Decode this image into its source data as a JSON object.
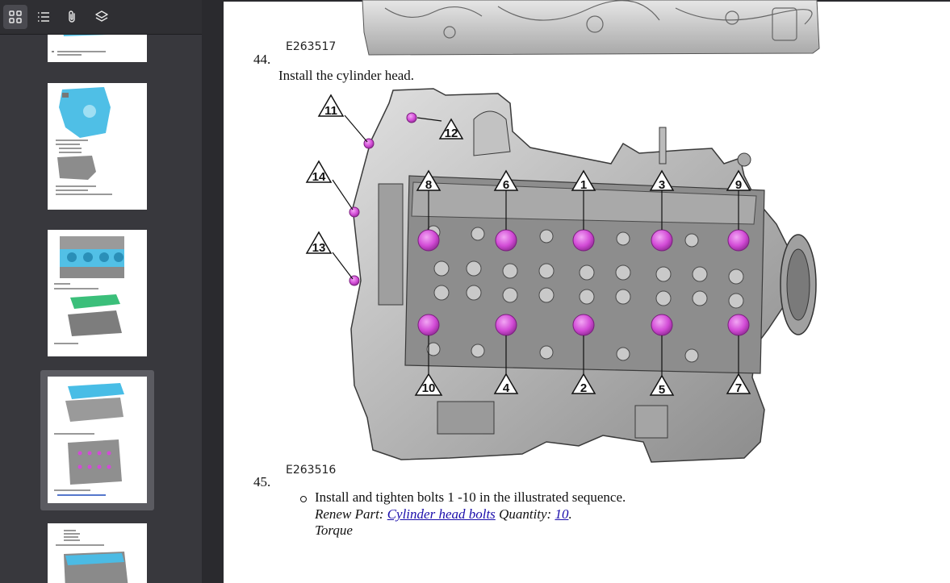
{
  "sidebar": {
    "toolbar": {
      "thumbnails_icon": "grid-icon",
      "outline_icon": "list-icon",
      "attachments_icon": "paperclip-icon",
      "layers_icon": "layers-icon"
    },
    "selected_thumbnail_index": 3
  },
  "document": {
    "figure_top_code": "E263517",
    "step44": {
      "number": "44.",
      "text": "Install the cylinder head."
    },
    "figure_main_code": "E263516",
    "step45": {
      "number": "45.",
      "instruction": "Install and tighten bolts 1 -10 in the illustrated sequence.",
      "renew_label": "Renew Part:",
      "renew_link": "Cylinder head bolts",
      "quantity_label": "Quantity:",
      "quantity_value": "10",
      "period": ".",
      "torque_label": "Torque"
    },
    "callouts": [
      "1",
      "2",
      "3",
      "4",
      "5",
      "6",
      "7",
      "8",
      "9",
      "10",
      "11",
      "12",
      "13",
      "14"
    ],
    "colors": {
      "bolt": "#d24bd6",
      "engine_light": "#d2d2d2",
      "engine_dark": "#6a6a6a"
    }
  }
}
